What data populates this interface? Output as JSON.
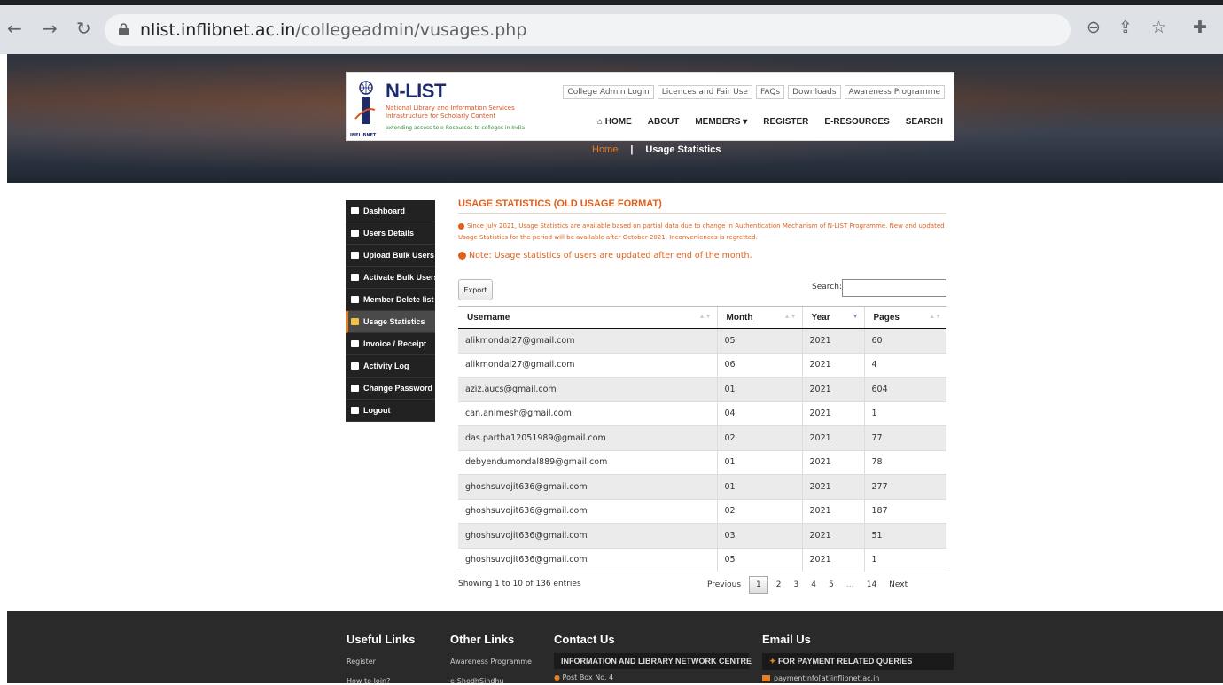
{
  "browser": {
    "url_host": "nlist.inflibnet.ac.in",
    "url_path": "/collegeadmin/vusages.php",
    "back_icon": "arrow-left-icon",
    "forward_icon": "arrow-right-icon",
    "reload_icon": "reload-icon",
    "lock_icon": "lock-icon",
    "zoom_icon": "zoom-out-icon",
    "share_icon": "share-icon",
    "star_icon": "star-icon",
    "extensions_icon": "puzzle-icon"
  },
  "header": {
    "logo_title": "N-LIST",
    "logo_line1": "National Library and Information Services",
    "logo_line2": "Infrastructure for Scholarly Content",
    "logo_line3": "extending access to e-Resources to colleges in India",
    "logo_badge": "INFLIBNET",
    "top_links": [
      "College Admin Login",
      "Licences and Fair Use",
      "FAQs",
      "Downloads",
      "Awareness Programme"
    ],
    "nav": {
      "home": "HOME",
      "about": "ABOUT",
      "members": "MEMBERS",
      "register": "REGISTER",
      "eresources": "E-RESOURCES",
      "search": "SEARCH"
    }
  },
  "breadcrumb": {
    "home": "Home",
    "separator": "|",
    "current": "Usage Statistics"
  },
  "sidebar": {
    "items": [
      {
        "label": "Dashboard",
        "icon": "dashboard-icon"
      },
      {
        "label": "Users Details",
        "icon": "users-icon"
      },
      {
        "label": "Upload Bulk Users",
        "icon": "upload-icon"
      },
      {
        "label": "Activate Bulk Users",
        "icon": "check-square-icon"
      },
      {
        "label": "Member Delete list",
        "icon": "trash-icon"
      },
      {
        "label": "Usage Statistics",
        "icon": "bar-chart-icon"
      },
      {
        "label": "Invoice / Receipt",
        "icon": "print-icon"
      },
      {
        "label": "Activity Log",
        "icon": "list-icon"
      },
      {
        "label": "Change Password",
        "icon": "key-icon"
      },
      {
        "label": "Logout",
        "icon": "sign-out-icon"
      }
    ],
    "active_index": 5
  },
  "main": {
    "title": "USAGE STATISTICS (OLD USAGE FORMAT)",
    "notice": "Since July 2021, Usage Statistics are available based on partial data due to change in Authentication Mechanism of N-LIST Programme. New and updated Usage Statistics for the period will be available after October 2021. Inconveniences is regretted.",
    "note": "Note: Usage statistics of users are updated after end of the month.",
    "export_label": "Export",
    "search_label": "Search:",
    "search_value": "",
    "columns": [
      "Username",
      "Month",
      "Year",
      "Pages"
    ],
    "rows": [
      [
        "alikmondal27@gmail.com",
        "05",
        "2021",
        "60"
      ],
      [
        "alikmondal27@gmail.com",
        "06",
        "2021",
        "4"
      ],
      [
        "aziz.aucs@gmail.com",
        "01",
        "2021",
        "604"
      ],
      [
        "can.animesh@gmail.com",
        "04",
        "2021",
        "1"
      ],
      [
        "das.partha12051989@gmail.com",
        "02",
        "2021",
        "77"
      ],
      [
        "debyendumondal889@gmail.com",
        "01",
        "2021",
        "78"
      ],
      [
        "ghoshsuvojit636@gmail.com",
        "01",
        "2021",
        "277"
      ],
      [
        "ghoshsuvojit636@gmail.com",
        "02",
        "2021",
        "187"
      ],
      [
        "ghoshsuvojit636@gmail.com",
        "03",
        "2021",
        "51"
      ],
      [
        "ghoshsuvojit636@gmail.com",
        "05",
        "2021",
        "1"
      ]
    ],
    "info": "Showing 1 to 10 of 136 entries",
    "pagination": {
      "previous": "Previous",
      "pages": [
        "1",
        "2",
        "3",
        "4",
        "5"
      ],
      "ellipsis": "…",
      "last": "14",
      "next": "Next",
      "current": "1"
    }
  },
  "footer": {
    "useful_links_title": "Useful Links",
    "useful_links": [
      "Register",
      "How to Join?"
    ],
    "other_links_title": "Other Links",
    "other_links": [
      "Awareness Programme",
      "e-ShodhSindhu"
    ],
    "contact_title": "Contact Us",
    "contact_org": "INFORMATION AND LIBRARY NETWORK CENTRE",
    "contact_line": "Post Box No. 4",
    "email_title": "Email Us",
    "email_heading": "FOR PAYMENT RELATED QUERIES",
    "email_value": "paymentinfo[at]inflibnet.ac.in"
  }
}
